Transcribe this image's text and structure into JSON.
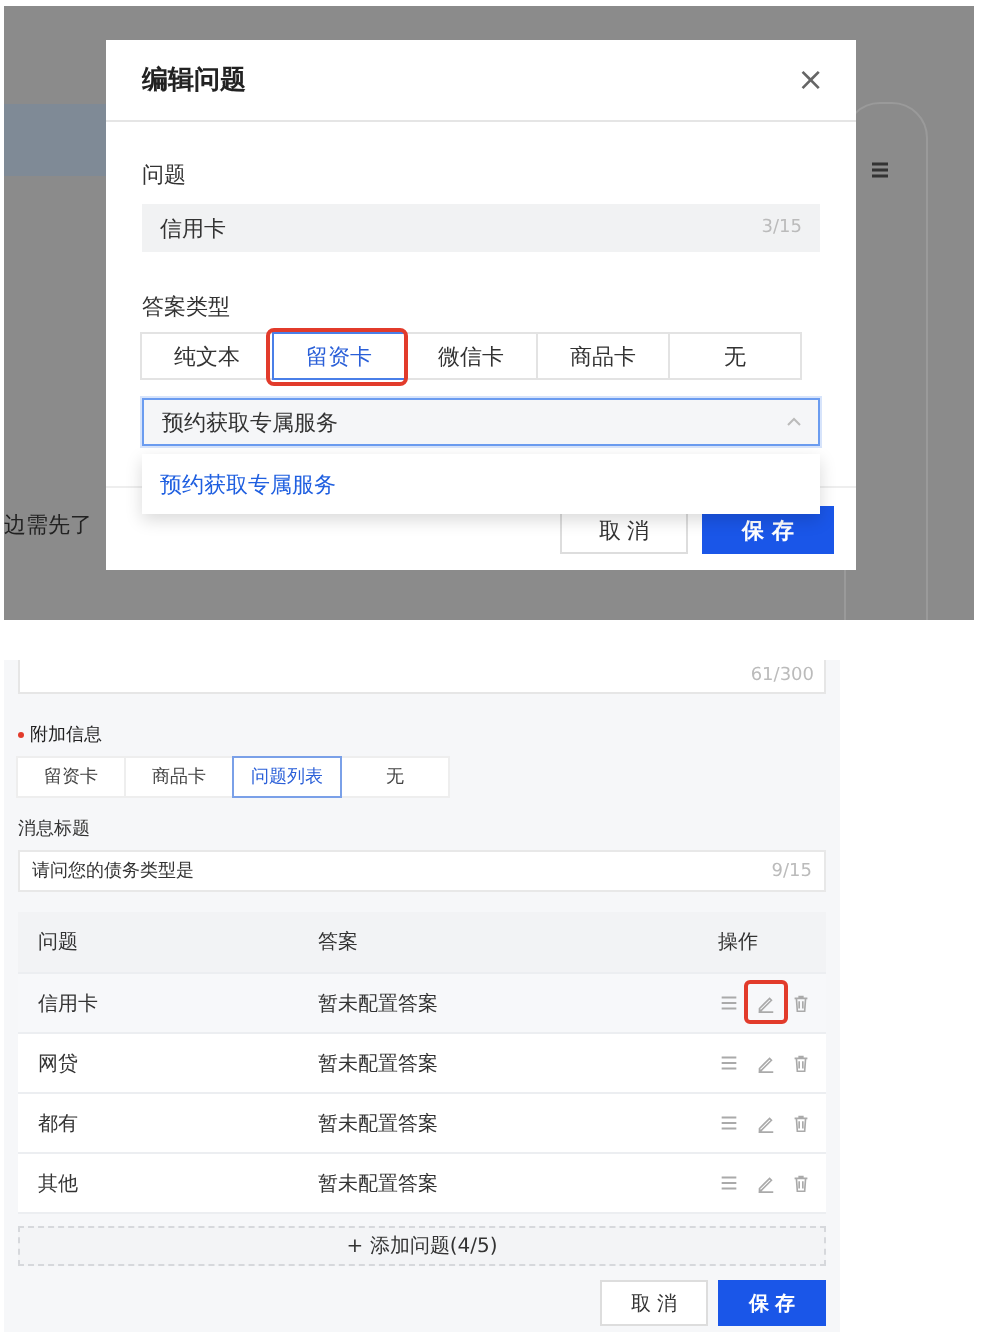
{
  "background": {
    "text": "边需先了"
  },
  "dialog": {
    "title": "编辑问题",
    "close": "×",
    "question_label": "问题",
    "question_value": "信用卡",
    "question_count": "3/15",
    "answer_type_label": "答案类型",
    "answer_types": [
      {
        "label": "纯文本",
        "selected": false,
        "highlighted": false
      },
      {
        "label": "留资卡",
        "selected": true,
        "highlighted": true
      },
      {
        "label": "微信卡",
        "selected": false,
        "highlighted": false
      },
      {
        "label": "商品卡",
        "selected": false,
        "highlighted": false
      },
      {
        "label": "无",
        "selected": false,
        "highlighted": false
      }
    ],
    "select": {
      "value": "预约获取专属服务",
      "expanded": true
    },
    "dropdown_options": [
      {
        "label": "预约获取专属服务",
        "selected": true
      }
    ],
    "buttons": [
      {
        "label": "取 消",
        "kind": "default"
      },
      {
        "label": "保 存",
        "kind": "primary"
      }
    ]
  },
  "form": {
    "description_count": "61/300",
    "extra_label": "附加信息",
    "required": true,
    "extra_types": [
      {
        "label": "留资卡",
        "selected": false
      },
      {
        "label": "商品卡",
        "selected": false
      },
      {
        "label": "问题列表",
        "selected": true
      },
      {
        "label": "无",
        "selected": false
      }
    ],
    "title_label": "消息标题",
    "title_value": "请问您的债务类型是",
    "title_count": "9/15",
    "table": {
      "columns": [
        "问题",
        "答案",
        "操作"
      ],
      "rows": [
        {
          "question": "信用卡",
          "answer": "暂未配置答案",
          "hovered": true,
          "edit_highlighted": true
        },
        {
          "question": "网贷",
          "answer": "暂未配置答案",
          "hovered": false,
          "edit_highlighted": false
        },
        {
          "question": "都有",
          "answer": "暂未配置答案",
          "hovered": false,
          "edit_highlighted": false
        },
        {
          "question": "其他",
          "answer": "暂未配置答案",
          "hovered": false,
          "edit_highlighted": false
        }
      ]
    },
    "add_button": "+ 添加问题(4/5)",
    "buttons": [
      {
        "label": "取 消",
        "kind": "default"
      },
      {
        "label": "保 存",
        "kind": "primary"
      }
    ]
  }
}
